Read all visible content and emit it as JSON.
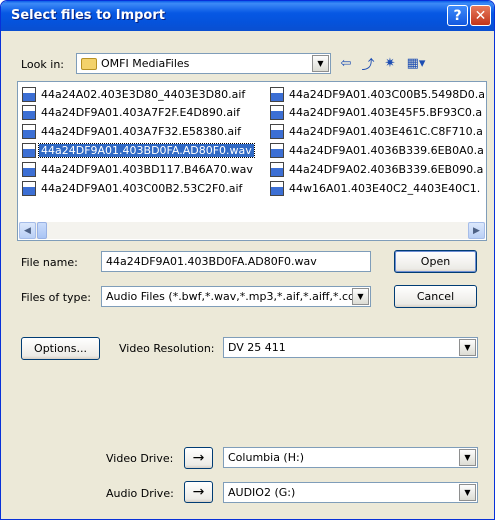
{
  "window": {
    "title": "Select files to Import"
  },
  "look_in": {
    "label": "Look in:",
    "value": "OMFI MediaFiles",
    "folder_icon": "folder-icon"
  },
  "toolbar_icons": [
    "back-icon",
    "up-folder-icon",
    "new-folder-icon",
    "view-menu-icon"
  ],
  "files": [
    {
      "name": "44a24A02.403E3D80_4403E3D80.aif",
      "selected": false
    },
    {
      "name": "44a24DF9A01.403A7F2F.E4D890.aif",
      "selected": false
    },
    {
      "name": "44a24DF9A01.403A7F32.E58380.aif",
      "selected": false
    },
    {
      "name": "44a24DF9A01.403BD0FA.AD80F0.wav",
      "selected": true
    },
    {
      "name": "44a24DF9A01.403BD117.B46A70.wav",
      "selected": false
    },
    {
      "name": "44a24DF9A01.403C00B2.53C2F0.aif",
      "selected": false
    },
    {
      "name": "44a24DF9A01.403C00B5.5498D0.a",
      "selected": false
    },
    {
      "name": "44a24DF9A01.403E45F5.BF93C0.a",
      "selected": false
    },
    {
      "name": "44a24DF9A01.403E461C.C8F710.a",
      "selected": false
    },
    {
      "name": "44a24DF9A01.4036B339.6EB0A0.a",
      "selected": false
    },
    {
      "name": "44a24DF9A02.4036B339.6EB090.a",
      "selected": false
    },
    {
      "name": "44w16A01.403E40C2_4403E40C1.",
      "selected": false
    }
  ],
  "file_name": {
    "label": "File name:",
    "value": "44a24DF9A01.403BD0FA.AD80F0.wav"
  },
  "files_of_type": {
    "label": "Files of type:",
    "value": "Audio Files (*.bwf,*.wav,*.mp3,*.aif,*.aiff,*.cd"
  },
  "buttons": {
    "open": "Open",
    "cancel": "Cancel",
    "options": "Options..."
  },
  "video_resolution": {
    "label": "Video Resolution:",
    "value": "DV 25 411"
  },
  "video_drive": {
    "label": "Video Drive:",
    "value": "Columbia (H:)",
    "arrow": "→"
  },
  "audio_drive": {
    "label": "Audio Drive:",
    "value": "AUDIO2 (G:)",
    "arrow": "→"
  },
  "colors": {
    "titlebar": "#0553dc",
    "selection": "#316ac5",
    "dialog_bg": "#ece9d8"
  }
}
